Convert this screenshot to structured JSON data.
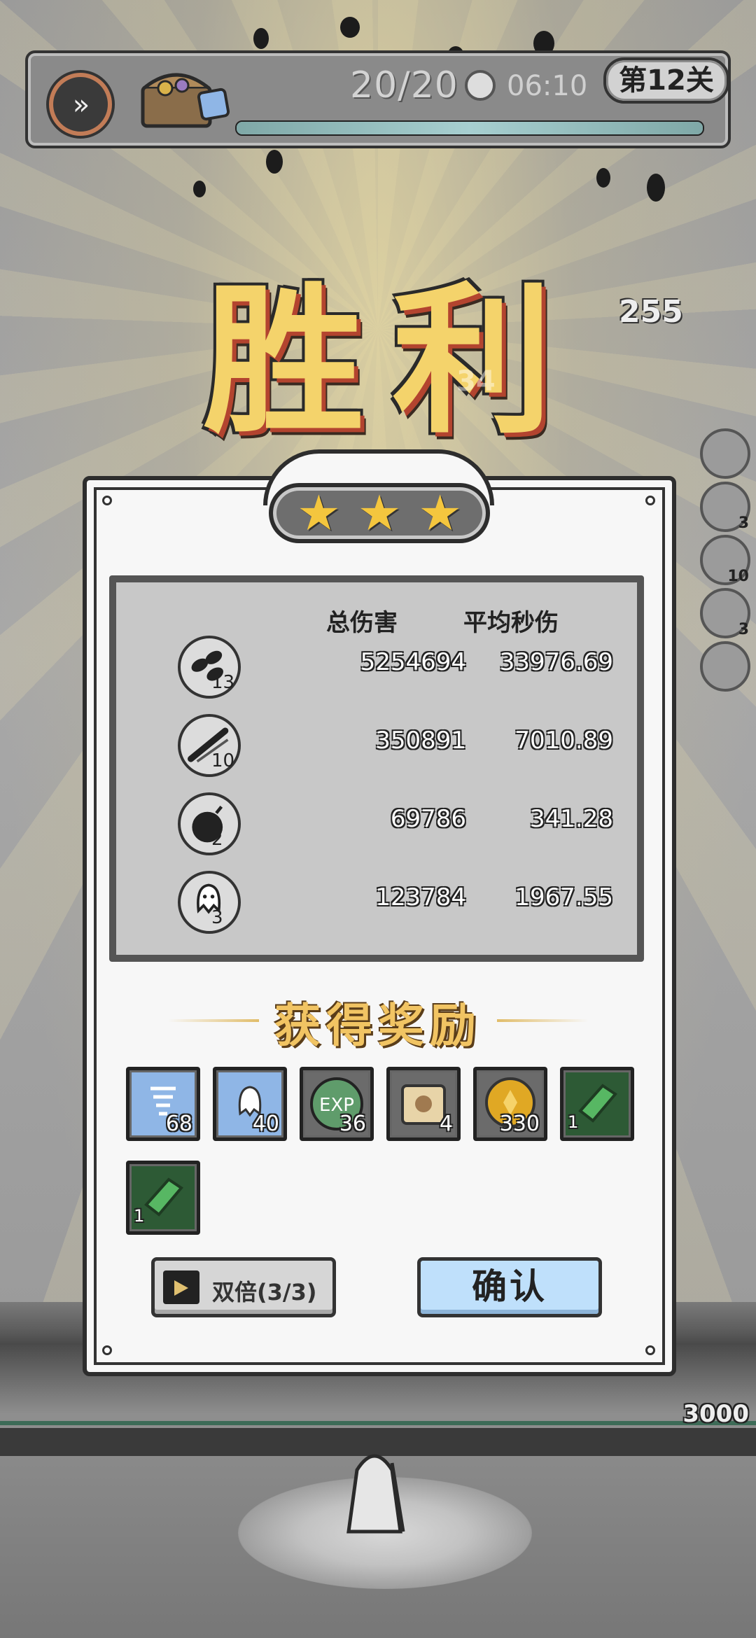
{
  "top_bar": {
    "wave_text": "20/20",
    "timer": "06:10",
    "stage_label": "第12关",
    "wave_progress": 1.0
  },
  "victory_title": "胜利",
  "floating_damage": "255",
  "floating_damage_faint": "34",
  "side_skill_levels": [
    "",
    "3",
    "",
    "10",
    "3"
  ],
  "stats": {
    "header_total": "总伤害",
    "header_dps": "平均秒伤",
    "rows": [
      {
        "icon": "seed-burst-skill-icon",
        "level": "13",
        "total": "5254694",
        "dps": "33976.69"
      },
      {
        "icon": "slash-skill-icon",
        "level": "10",
        "total": "350891",
        "dps": "7010.89"
      },
      {
        "icon": "bomb-skill-icon",
        "level": "2",
        "total": "69786",
        "dps": "341.28"
      },
      {
        "icon": "ghost-skill-icon",
        "level": "3",
        "total": "123784",
        "dps": "1967.55"
      }
    ]
  },
  "stars": 3,
  "rewards_title": "获得奖励",
  "rewards": [
    {
      "icon": "tornado-crystal-icon",
      "count": "68",
      "bg": "#8fb6e6"
    },
    {
      "icon": "ghost-crystal-icon",
      "count": "40",
      "bg": "#8fb6e6"
    },
    {
      "icon": "exp-icon",
      "count": "36",
      "bg": "#6b6b6b"
    },
    {
      "icon": "scroll-icon",
      "count": "4",
      "bg": "#6b6b6b"
    },
    {
      "icon": "gold-coin-icon",
      "count": "330",
      "bg": "#6b6b6b"
    },
    {
      "icon": "green-gem-icon",
      "count": "1",
      "bg": "#2d5a35"
    },
    {
      "icon": "green-gem-icon",
      "count": "1",
      "bg": "#2d5a35"
    }
  ],
  "buttons": {
    "double_label": "双倍(3/3)",
    "confirm_label": "确认"
  },
  "base_hp": "3000",
  "colors": {
    "title_gold": "#f4d36b",
    "star": "#f4c63e",
    "confirm_bg": "#bfe0fb"
  }
}
